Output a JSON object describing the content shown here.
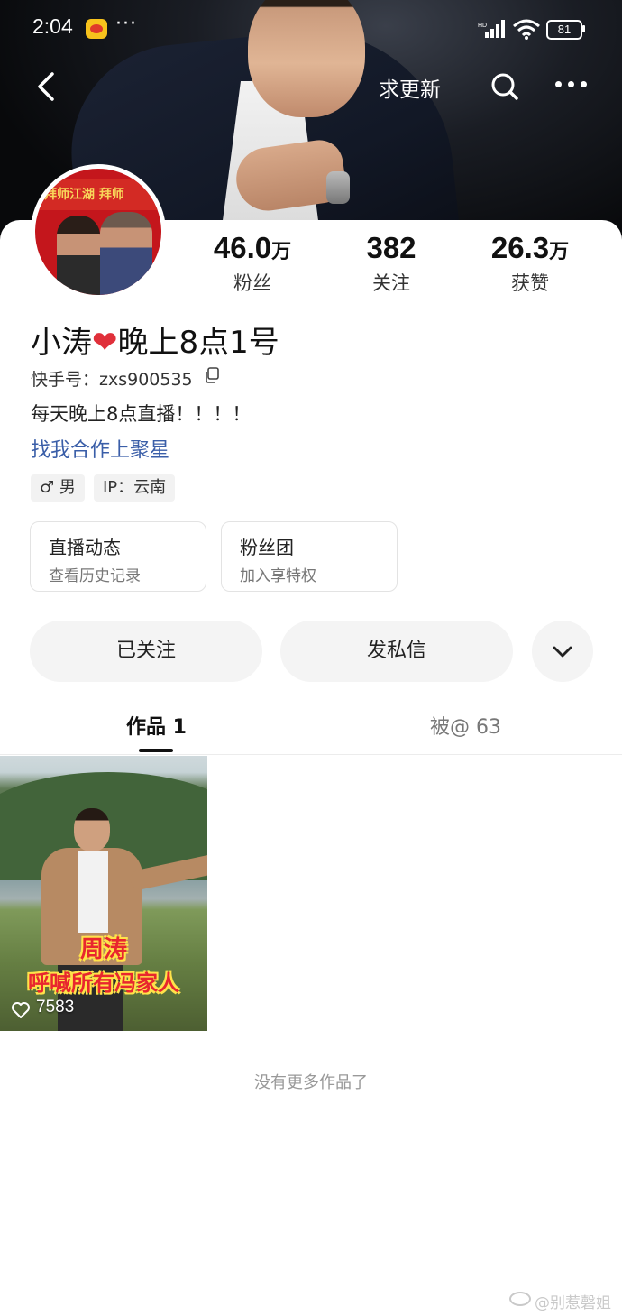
{
  "status_bar": {
    "time": "2:04",
    "dots": "···",
    "battery": "81"
  },
  "nav": {
    "request_update": "求更新"
  },
  "profile": {
    "name_part1": "小涛",
    "name_part2": "晚上8点1号",
    "kwai_id": "快手号：zxs900535",
    "bio": "每天晚上8点直播！！！！",
    "collab_link": "找我合作上聚星",
    "gender_tag": "♂ 男",
    "ip_tag": "IP：云南",
    "avatar_text": "拜师江湖 拜师"
  },
  "stats": [
    {
      "num": "46.0",
      "unit": "万",
      "label": "粉丝"
    },
    {
      "num": "382",
      "unit": "",
      "label": "关注"
    },
    {
      "num": "26.3",
      "unit": "万",
      "label": "获赞"
    }
  ],
  "cards": {
    "live": {
      "title": "直播动态",
      "sub": "查看历史记录"
    },
    "fan": {
      "title": "粉丝团",
      "sub": "加入享特权"
    }
  },
  "actions": {
    "follow": "已关注",
    "message": "发私信"
  },
  "tabs": {
    "works": "作品 1",
    "mentioned": "被@ 63"
  },
  "video": {
    "caption1": "周涛",
    "caption2": "呼喊所有冯家人",
    "likes": "7583"
  },
  "no_more": "没有更多作品了",
  "watermark": "@别惹磬姐",
  "colors": {
    "link": "#3a5ea8",
    "heart": "#e0303a",
    "caption": "#e8262e"
  }
}
